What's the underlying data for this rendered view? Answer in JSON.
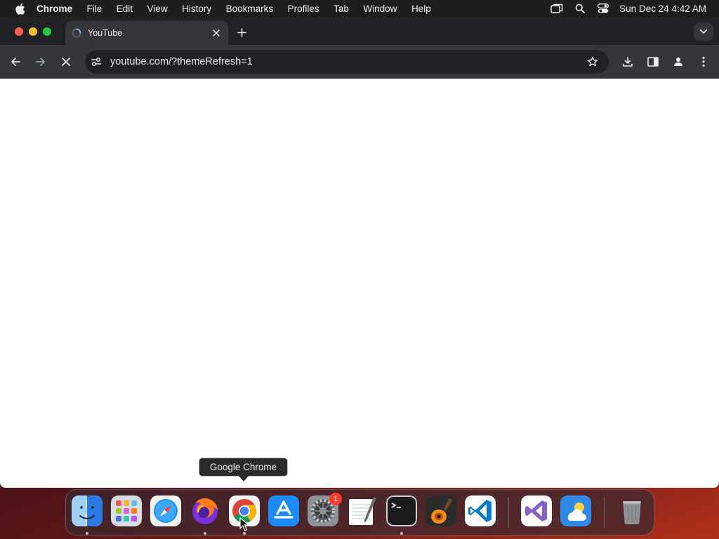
{
  "menubar": {
    "app_name": "Chrome",
    "items": [
      "File",
      "Edit",
      "View",
      "History",
      "Bookmarks",
      "Profiles",
      "Tab",
      "Window",
      "Help"
    ],
    "clock": "Sun Dec 24  4:42 AM"
  },
  "browser": {
    "tab_title": "YouTube",
    "url": "youtube.com/?themeRefresh=1",
    "loading": true
  },
  "dock": {
    "tooltip": "Google Chrome",
    "apps": [
      "Finder",
      "Launchpad",
      "Safari",
      "Firefox",
      "Google Chrome",
      "App Store",
      "System Settings",
      "TextEdit",
      "Terminal",
      "GarageBand",
      "Visual Studio Code",
      "Visual Studio",
      "Weather",
      "Trash"
    ],
    "system_settings_badge": "1"
  },
  "colors": {
    "tabstrip": "#202124",
    "toolbar": "#35363a",
    "accent_close": "#ff5f57",
    "accent_min": "#febc2e",
    "accent_max": "#28c840"
  }
}
